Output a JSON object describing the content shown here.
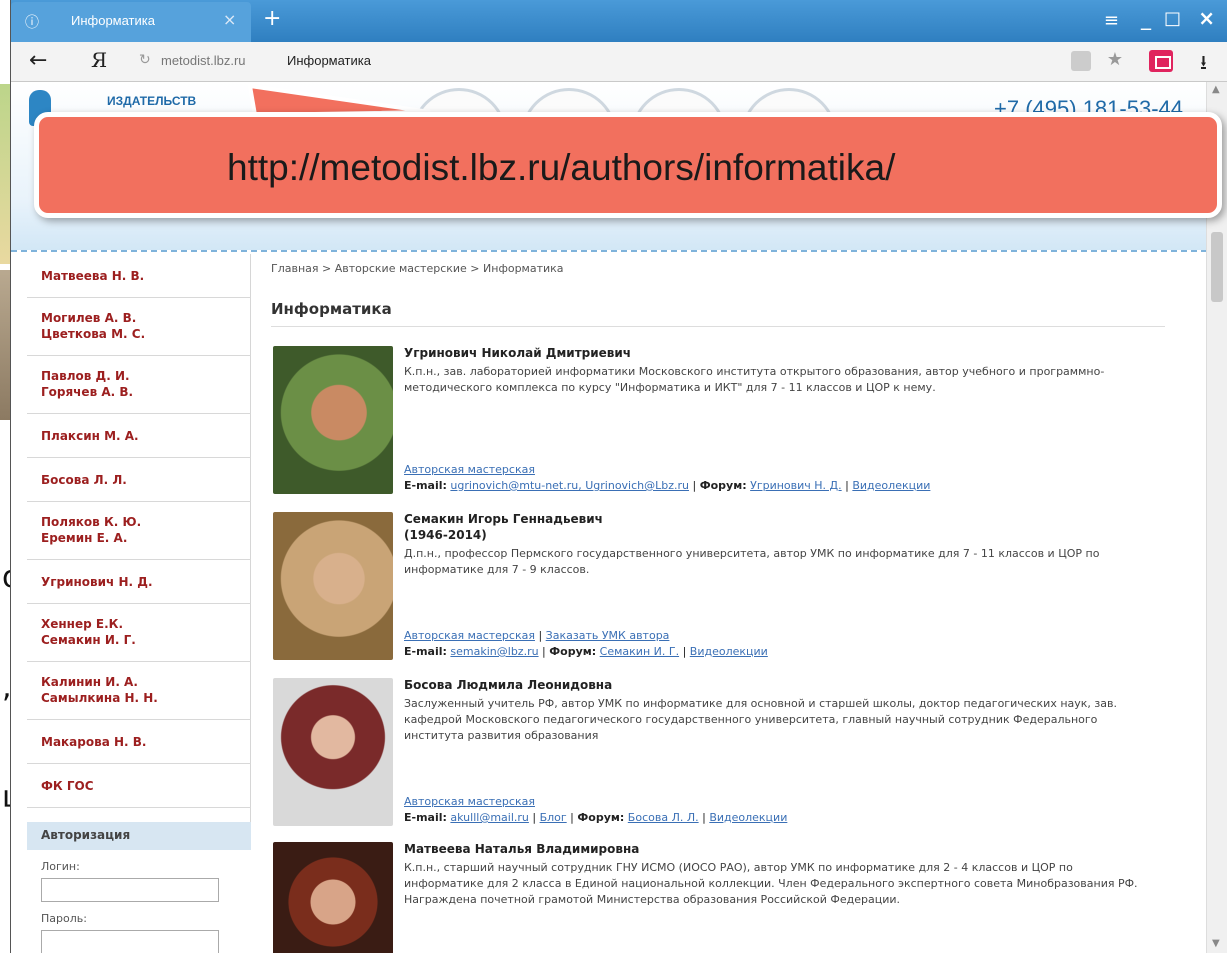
{
  "browser": {
    "tab_title": "Информатика",
    "tab_close": "×",
    "new_tab": "+",
    "favicon": "ⓘ",
    "window_controls": {
      "menu": "≡",
      "minimize": "_",
      "maximize": "□",
      "close": "×"
    },
    "back": "←",
    "yandex_button": "Я",
    "reload_icon": "↻",
    "url_host": "metodist.lbz.ru",
    "url_page_title": "Информатика",
    "star": "★",
    "download": "⭳"
  },
  "callout": {
    "url": "http://metodist.lbz.ru/authors/informatika/"
  },
  "header": {
    "logo_text": "ИЗДАТЕЛЬСТВ",
    "phone": "+7 (495) 181-53-44"
  },
  "sidebar": {
    "items": [
      {
        "label": "Матвеева Н. В."
      },
      {
        "label": "Могилев А. В.\nЦветкова М. С."
      },
      {
        "label": "Павлов Д. И.\nГорячев А. В."
      },
      {
        "label": "Плаксин М. А."
      },
      {
        "label": "Босова Л. Л."
      },
      {
        "label": "Поляков К. Ю.\nЕремин Е. А."
      },
      {
        "label": "Угринович Н. Д."
      },
      {
        "label": "Хеннер Е.К.\nСемакин И. Г."
      },
      {
        "label": "Калинин И. А.\nСамылкина Н. Н."
      },
      {
        "label": "Макарова Н. В."
      },
      {
        "label": "ФК ГОС"
      }
    ],
    "auth": {
      "title": "Авторизация",
      "login_label": "Логин:",
      "password_label": "Пароль:"
    }
  },
  "main": {
    "breadcrumb": "Главная > Авторские мастерские > Информатика",
    "title": "Информатика",
    "authors": [
      {
        "name": "Угринович Николай Дмитриевич",
        "years": "",
        "desc": "К.п.н., зав. лабораторией информатики Московского института открытого образования, автор учебного и программно-методического комплекса по курсу \"Информатика и ИКТ\" для 7 - 11 классов и ЦОР к нему.",
        "workshop": "Авторская мастерская",
        "extra_link": "",
        "email_label": "E-mail:",
        "emails": "ugrinovich@mtu-net.ru, Ugrinovich@Lbz.ru",
        "forum_label": "Форум:",
        "forum": "Угринович Н. Д.",
        "video": "Видеолекции",
        "photo_colors": [
          "#3e5a2a",
          "#6b8f46",
          "#c98a63"
        ]
      },
      {
        "name": "Семакин Игорь Геннадьевич",
        "years": "(1946-2014)",
        "desc": "Д.п.н., профессор Пермского государственного университета, автор УМК по информатике для 7 - 11 классов и ЦОР по информатике для 7 - 9 классов.",
        "workshop": "Авторская мастерская",
        "extra_link": "Заказать УМК автора",
        "email_label": "E-mail:",
        "emails": "semakin@lbz.ru",
        "forum_label": "Форум:",
        "forum": "Семакин И. Г.",
        "video": "Видеолекции",
        "photo_colors": [
          "#8a6a3c",
          "#c9a476",
          "#d8b08c"
        ]
      },
      {
        "name": "Босова Людмила Леонидовна",
        "years": "",
        "desc": "Заслуженный учитель РФ, автор УМК по информатике для основной и старшей школы, доктор педагогических наук, зав. кафедрой Московского педагогического государственного университета, главный научный сотрудник Федерального института развития образования",
        "workshop": "Авторская мастерская",
        "extra_link": "",
        "email_label": "E-mail:",
        "emails": "akulll@mail.ru",
        "blog": "Блог",
        "forum_label": "Форум:",
        "forum": "Босова Л. Л.",
        "video": "Видеолекции",
        "photo_colors": [
          "#d9d9d9",
          "#7a2a2a",
          "#e2b8a0"
        ]
      },
      {
        "name": "Матвеева Наталья Владимировна",
        "years": "",
        "desc": "К.п.н., старший научный сотрудник ГНУ ИСМО (ИОСО РАО), автор УМК по информатике для 2 - 4 классов и ЦОР по информатике для 2 класса в Единой национальной коллекции. Член Федерального экспертного совета Минобразования РФ. Награждена почетной грамотой Министерства образования Российской Федерации.",
        "photo_colors": [
          "#3a1c14",
          "#7a2d1c",
          "#d8a488"
        ]
      }
    ]
  },
  "slide_glyphs": [
    "о",
    ",",
    "ц"
  ]
}
